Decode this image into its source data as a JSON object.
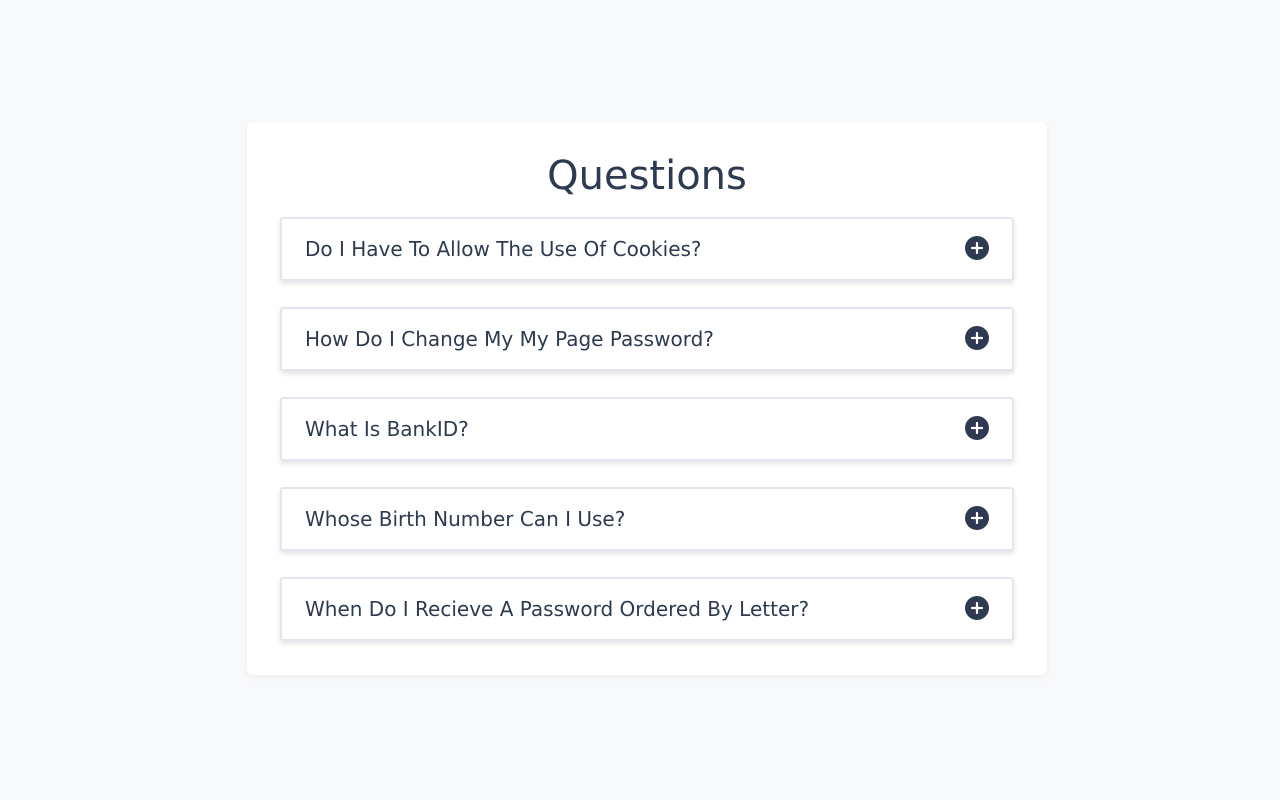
{
  "page": {
    "title": "Questions"
  },
  "faq": {
    "items": [
      {
        "question": "Do I Have To Allow The Use Of Cookies?",
        "icon": "plus-circle-icon"
      },
      {
        "question": "How Do I Change My My Page Password?",
        "icon": "plus-circle-icon"
      },
      {
        "question": "What Is BankID?",
        "icon": "plus-circle-icon"
      },
      {
        "question": "Whose Birth Number Can I Use?",
        "icon": "plus-circle-icon"
      },
      {
        "question": "When Do I Recieve A Password Ordered By Letter?",
        "icon": "plus-circle-icon"
      }
    ]
  },
  "colors": {
    "background": "#f8f9fb",
    "card": "#ffffff",
    "text": "#2d3a4f",
    "border": "#e3e6ee"
  }
}
